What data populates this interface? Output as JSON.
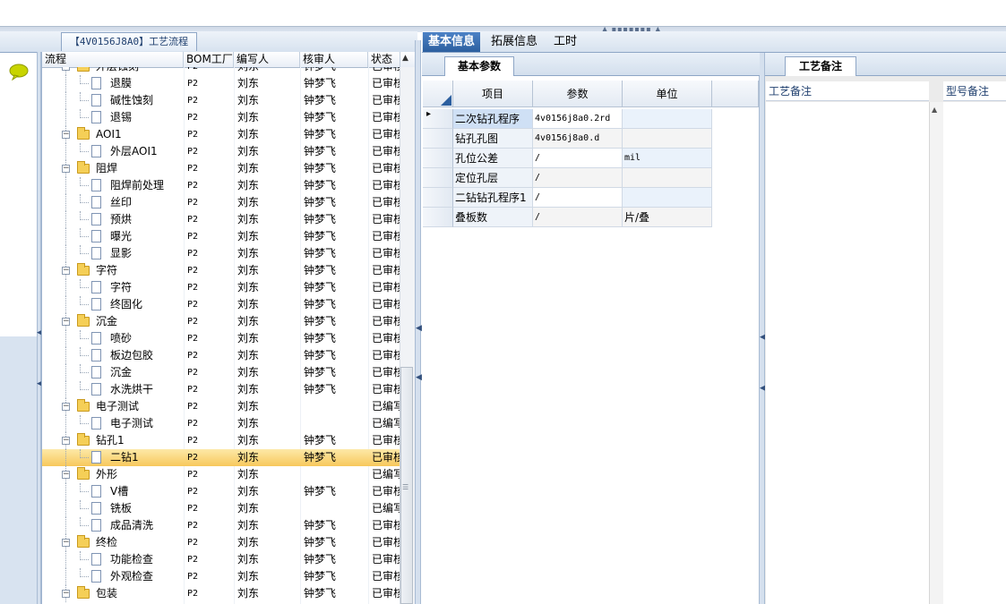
{
  "process_tab": {
    "label": "【4V0156J8A0】工艺流程"
  },
  "tree": {
    "columns": [
      "流程",
      "BOM工厂",
      "编写人",
      "核审人",
      "状态"
    ],
    "rows": [
      {
        "name": "外层蚀刻",
        "level": 1,
        "bom": "P2",
        "writer": "刘东",
        "reviewer": "钟梦飞",
        "status": "已审核",
        "partial": true
      },
      {
        "name": "退膜",
        "level": 2,
        "bom": "P2",
        "writer": "刘东",
        "reviewer": "钟梦飞",
        "status": "已审核"
      },
      {
        "name": "碱性蚀刻",
        "level": 2,
        "bom": "P2",
        "writer": "刘东",
        "reviewer": "钟梦飞",
        "status": "已审核"
      },
      {
        "name": "退锡",
        "level": 2,
        "bom": "P2",
        "writer": "刘东",
        "reviewer": "钟梦飞",
        "status": "已审核"
      },
      {
        "name": "AOI1",
        "level": 1,
        "bom": "P2",
        "writer": "刘东",
        "reviewer": "钟梦飞",
        "status": "已审核"
      },
      {
        "name": "外层AOI1",
        "level": 2,
        "bom": "P2",
        "writer": "刘东",
        "reviewer": "钟梦飞",
        "status": "已审核"
      },
      {
        "name": "阻焊",
        "level": 1,
        "bom": "P2",
        "writer": "刘东",
        "reviewer": "钟梦飞",
        "status": "已审核"
      },
      {
        "name": "阻焊前处理",
        "level": 2,
        "bom": "P2",
        "writer": "刘东",
        "reviewer": "钟梦飞",
        "status": "已审核"
      },
      {
        "name": "丝印",
        "level": 2,
        "bom": "P2",
        "writer": "刘东",
        "reviewer": "钟梦飞",
        "status": "已审核"
      },
      {
        "name": "预烘",
        "level": 2,
        "bom": "P2",
        "writer": "刘东",
        "reviewer": "钟梦飞",
        "status": "已审核"
      },
      {
        "name": "曝光",
        "level": 2,
        "bom": "P2",
        "writer": "刘东",
        "reviewer": "钟梦飞",
        "status": "已审核"
      },
      {
        "name": "显影",
        "level": 2,
        "bom": "P2",
        "writer": "刘东",
        "reviewer": "钟梦飞",
        "status": "已审核"
      },
      {
        "name": "字符",
        "level": 1,
        "bom": "P2",
        "writer": "刘东",
        "reviewer": "钟梦飞",
        "status": "已审核"
      },
      {
        "name": "字符",
        "level": 2,
        "bom": "P2",
        "writer": "刘东",
        "reviewer": "钟梦飞",
        "status": "已审核"
      },
      {
        "name": "终固化",
        "level": 2,
        "bom": "P2",
        "writer": "刘东",
        "reviewer": "钟梦飞",
        "status": "已审核"
      },
      {
        "name": "沉金",
        "level": 1,
        "bom": "P2",
        "writer": "刘东",
        "reviewer": "钟梦飞",
        "status": "已审核"
      },
      {
        "name": "喷砂",
        "level": 2,
        "bom": "P2",
        "writer": "刘东",
        "reviewer": "钟梦飞",
        "status": "已审核"
      },
      {
        "name": "板边包胶",
        "level": 2,
        "bom": "P2",
        "writer": "刘东",
        "reviewer": "钟梦飞",
        "status": "已审核"
      },
      {
        "name": "沉金",
        "level": 2,
        "bom": "P2",
        "writer": "刘东",
        "reviewer": "钟梦飞",
        "status": "已审核"
      },
      {
        "name": "水洗烘干",
        "level": 2,
        "bom": "P2",
        "writer": "刘东",
        "reviewer": "钟梦飞",
        "status": "已审核"
      },
      {
        "name": "电子测试",
        "level": 1,
        "bom": "P2",
        "writer": "刘东",
        "reviewer": "",
        "status": "已编写"
      },
      {
        "name": "电子测试",
        "level": 2,
        "bom": "P2",
        "writer": "刘东",
        "reviewer": "",
        "status": "已编写"
      },
      {
        "name": "钻孔1",
        "level": 1,
        "bom": "P2",
        "writer": "刘东",
        "reviewer": "钟梦飞",
        "status": "已审核"
      },
      {
        "name": "二钻1",
        "level": 2,
        "bom": "P2",
        "writer": "刘东",
        "reviewer": "钟梦飞",
        "status": "已审核",
        "selected": true
      },
      {
        "name": "外形",
        "level": 1,
        "bom": "P2",
        "writer": "刘东",
        "reviewer": "",
        "status": "已编写"
      },
      {
        "name": "V槽",
        "level": 2,
        "bom": "P2",
        "writer": "刘东",
        "reviewer": "钟梦飞",
        "status": "已审核"
      },
      {
        "name": "铣板",
        "level": 2,
        "bom": "P2",
        "writer": "刘东",
        "reviewer": "",
        "status": "已编写"
      },
      {
        "name": "成品清洗",
        "level": 2,
        "bom": "P2",
        "writer": "刘东",
        "reviewer": "钟梦飞",
        "status": "已审核"
      },
      {
        "name": "终检",
        "level": 1,
        "bom": "P2",
        "writer": "刘东",
        "reviewer": "钟梦飞",
        "status": "已审核"
      },
      {
        "name": "功能检查",
        "level": 2,
        "bom": "P2",
        "writer": "刘东",
        "reviewer": "钟梦飞",
        "status": "已审核"
      },
      {
        "name": "外观检查",
        "level": 2,
        "bom": "P2",
        "writer": "刘东",
        "reviewer": "钟梦飞",
        "status": "已审核"
      },
      {
        "name": "包装",
        "level": 1,
        "bom": "P2",
        "writer": "刘东",
        "reviewer": "钟梦飞",
        "status": "已审核"
      }
    ]
  },
  "top_tabs": [
    {
      "label": "基本信息",
      "active": true
    },
    {
      "label": "拓展信息",
      "active": false
    },
    {
      "label": "工时",
      "active": false
    }
  ],
  "params_panel": {
    "tab_label": "基本参数",
    "columns": [
      "项目",
      "参数",
      "单位"
    ],
    "rows": [
      {
        "item": "二次钻孔程序",
        "param": "4v0156j8a0.2rd",
        "unit": "",
        "current": true
      },
      {
        "item": "钻孔孔图",
        "param": "4v0156j8a0.d",
        "unit": ""
      },
      {
        "item": "孔位公差",
        "param": "/",
        "unit": "mil"
      },
      {
        "item": "定位孔层",
        "param": "/",
        "unit": ""
      },
      {
        "item": "二钻钻孔程序1",
        "param": "/",
        "unit": ""
      },
      {
        "item": "叠板数",
        "param": "/",
        "unit": "片/叠"
      }
    ]
  },
  "notes_panel": {
    "tab_label": "工艺备注",
    "columns": [
      "工艺备注",
      "型号备注"
    ]
  },
  "colors": {
    "accent": "#2c5f9f",
    "selection": "#f7c85c",
    "folder": "#f5cf57"
  },
  "icons": {
    "chat": "speech-bubble-icon",
    "folder": "folder-icon",
    "document": "document-icon"
  }
}
